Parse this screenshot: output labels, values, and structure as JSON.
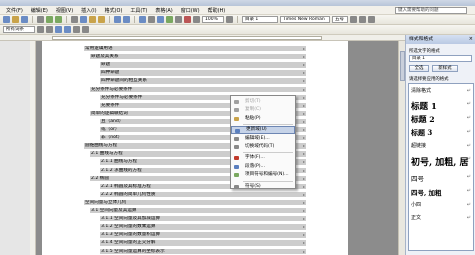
{
  "menubar": {
    "items": [
      "文件(F)",
      "编辑(E)",
      "视图(V)",
      "插入(I)",
      "格式(O)",
      "工具(T)",
      "表格(A)",
      "窗口(W)",
      "帮助(H)"
    ],
    "help_placeholder": "键入需要帮助的问题"
  },
  "toolbar": {
    "zoom": "100%",
    "style_combo": "目录 1",
    "font_combo": "Times New Roman",
    "size_combo": "五号",
    "view_combo": "所有词条"
  },
  "document": {
    "lines": [
      {
        "text": "常用逻辑用语",
        "level": 0
      },
      {
        "text": "命题及其关系",
        "level": 1
      },
      {
        "text": "命题",
        "level": 2
      },
      {
        "text": "四种命题",
        "level": 2
      },
      {
        "text": "四种命题间的相互关系",
        "level": 2
      },
      {
        "text": "充分条件与必要条件",
        "level": 1
      },
      {
        "text": "充分条件与必要条件",
        "level": 2
      },
      {
        "text": "充要条件",
        "level": 2
      },
      {
        "text": "简单的逻辑联结词",
        "level": 1
      },
      {
        "text": "且（and）",
        "level": 2
      },
      {
        "text": "或（or）",
        "level": 2
      },
      {
        "text": "非（not）",
        "level": 2
      },
      {
        "text": "圆锥曲线与方程",
        "level": 0
      },
      {
        "text": "2.1 曲线与方程",
        "level": 1
      },
      {
        "text": "2.1.1 曲线与方程",
        "level": 2
      },
      {
        "text": "2.1.2 求曲线的方程",
        "level": 2
      },
      {
        "text": "2.2 椭圆",
        "level": 1
      },
      {
        "text": "2.2.1 椭圆及其标准方程",
        "level": 2
      },
      {
        "text": "2.2.2 椭圆的简单几何性质",
        "level": 2
      },
      {
        "text": "空间向量与立体几何",
        "level": 0
      },
      {
        "text": "3.1 空间向量及其运算",
        "level": 1
      },
      {
        "text": "3.1.1 空间向量及其加减运算",
        "level": 2
      },
      {
        "text": "3.1.2 空间向量的数乘运算",
        "level": 2
      },
      {
        "text": "3.1.3 空间向量的数量积运算",
        "level": 2
      },
      {
        "text": "3.1.4 空间向量的正交分解",
        "level": 2
      },
      {
        "text": "3.1.5 空间向量运算的坐标表示",
        "level": 2
      }
    ]
  },
  "context_menu": {
    "items": [
      {
        "label": "剪切(T)",
        "disabled": true,
        "color": "#a0a0a0"
      },
      {
        "label": "复制(C)",
        "disabled": true,
        "color": "#a0a0a0"
      },
      {
        "label": "粘贴(P)",
        "disabled": false,
        "color": "#c9a34a"
      },
      {
        "label": "更新域(U)",
        "disabled": false,
        "highlighted": true,
        "color": "#5a7fbf"
      },
      {
        "label": "编辑域(E)...",
        "disabled": false,
        "color": "#888888"
      },
      {
        "label": "切换域代码(T)",
        "disabled": false,
        "color": "#888888"
      },
      {
        "label": "字体(F)...",
        "disabled": false,
        "color": "#c0392b"
      },
      {
        "label": "段落(P)...",
        "disabled": false,
        "color": "#5a7fbf"
      },
      {
        "label": "项目符号和编号(N)...",
        "disabled": false,
        "color": "#7aa860"
      },
      {
        "label": "符号(S)",
        "disabled": false,
        "color": "#888888"
      }
    ]
  },
  "side_panel": {
    "title": "样式和格式",
    "current_label": "所选文字的格式",
    "current_value": "目录 1",
    "select_all": "全选",
    "new_style": "新样式",
    "apply_label": "请选择要应用的格式",
    "styles": [
      {
        "label": "清除格式",
        "size": "small"
      },
      {
        "label": "标题 1",
        "size": "h1"
      },
      {
        "label": "标题 2",
        "size": "h2"
      },
      {
        "label": "标题 3",
        "size": "h3"
      },
      {
        "label": "超链接",
        "size": "small"
      },
      {
        "label": "初号, 加粗, 居",
        "size": "big"
      },
      {
        "label": "四号",
        "size": "mid"
      },
      {
        "label": "四号, 加粗",
        "size": "midbold"
      },
      {
        "label": "小四",
        "size": "small"
      },
      {
        "label": "正文",
        "size": "small"
      }
    ]
  }
}
